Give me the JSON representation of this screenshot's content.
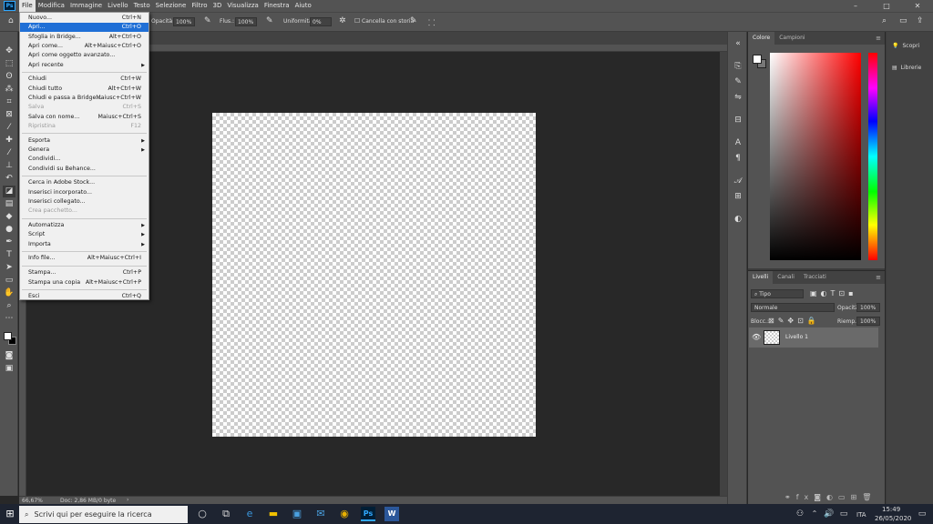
{
  "menubar": {
    "logo": "Ps",
    "items": [
      "File",
      "Modifica",
      "Immagine",
      "Livello",
      "Testo",
      "Selezione",
      "Filtro",
      "3D",
      "Visualizza",
      "Finestra",
      "Aiuto"
    ],
    "window_controls": [
      "–",
      "□",
      "✕"
    ]
  },
  "options": {
    "opacity_label": "Opacità:",
    "opacity_value": "100%",
    "flow_label": "Flus.:",
    "flow_value": "100%",
    "smooth_label": "Uniformità:",
    "smooth_value": "0%",
    "erase_history_label": "Cancella con storia"
  },
  "file_menu": {
    "items": [
      {
        "label": "Nuovo...",
        "shortcut": "Ctrl+N"
      },
      {
        "label": "Apri...",
        "shortcut": "Ctrl+O",
        "highlighted": true
      },
      {
        "label": "Sfoglia in Bridge...",
        "shortcut": "Alt+Ctrl+O"
      },
      {
        "label": "Apri come...",
        "shortcut": "Alt+Maiusc+Ctrl+O"
      },
      {
        "label": "Apri come oggetto avanzato...",
        "shortcut": ""
      },
      {
        "label": "Apri recente",
        "shortcut": "",
        "submenu": true
      },
      {
        "label": "Chiudi",
        "shortcut": "Ctrl+W"
      },
      {
        "label": "Chiudi tutto",
        "shortcut": "Alt+Ctrl+W"
      },
      {
        "label": "Chiudi e passa a Bridge...",
        "shortcut": "Maiusc+Ctrl+W"
      },
      {
        "label": "Salva",
        "shortcut": "Ctrl+S",
        "disabled": true
      },
      {
        "label": "Salva con nome...",
        "shortcut": "Maiusc+Ctrl+S"
      },
      {
        "label": "Ripristina",
        "shortcut": "F12",
        "disabled": true
      },
      {
        "label": "Esporta",
        "shortcut": "",
        "submenu": true
      },
      {
        "label": "Genera",
        "shortcut": "",
        "submenu": true
      },
      {
        "label": "Condividi...",
        "shortcut": ""
      },
      {
        "label": "Condividi su Behance...",
        "shortcut": ""
      },
      {
        "label": "Cerca in Adobe Stock...",
        "shortcut": ""
      },
      {
        "label": "Inserisci incorporato...",
        "shortcut": ""
      },
      {
        "label": "Inserisci collegato...",
        "shortcut": ""
      },
      {
        "label": "Crea pacchetto...",
        "shortcut": "",
        "disabled": true
      },
      {
        "label": "Automatizza",
        "shortcut": "",
        "submenu": true
      },
      {
        "label": "Script",
        "shortcut": "",
        "submenu": true
      },
      {
        "label": "Importa",
        "shortcut": "",
        "submenu": true
      },
      {
        "label": "Info file...",
        "shortcut": "Alt+Maiusc+Ctrl+I"
      },
      {
        "label": "Stampa...",
        "shortcut": "Ctrl+P"
      },
      {
        "label": "Stampa una copia",
        "shortcut": "Alt+Maiusc+Ctrl+P"
      },
      {
        "label": "Esci",
        "shortcut": "Ctrl+Q"
      }
    ]
  },
  "status": {
    "zoom": "66,67%",
    "doc": "Doc: 2,86 MB/0 byte"
  },
  "color_panel": {
    "tabs": [
      "Colore",
      "Campioni"
    ]
  },
  "layers_panel": {
    "tabs": [
      "Livelli",
      "Canali",
      "Tracciati"
    ],
    "filter": "Tipo",
    "blend_mode": "Normale",
    "opacity_label": "Opacità:",
    "opacity_value": "100%",
    "lock_label": "Blocc.:",
    "fill_label": "Riemp.:",
    "fill_value": "100%",
    "layer_name": "Livello 1"
  },
  "right_panels": {
    "discover": "Scopri",
    "libraries": "Librerie"
  },
  "taskbar": {
    "search_placeholder": "Scrivi qui per eseguire la ricerca",
    "lang": "ITA",
    "time": "15:49",
    "date": "26/05/2020",
    "ps_label": "Ps",
    "word_label": "W"
  },
  "colors": {
    "accent": "#1f6fd6",
    "ps_blue": "#31a8ff"
  }
}
